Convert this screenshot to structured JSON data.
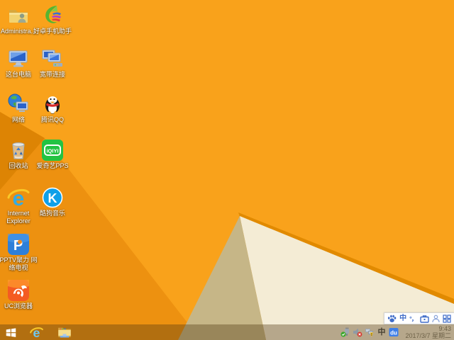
{
  "colors": {
    "base": "#F9A21B",
    "shade_mid": "#ED9110",
    "shade_dark": "#DD8404",
    "fold": "#E18A00",
    "cream": "#F4ECD5",
    "tan": "#C6B687",
    "accent_blue": "#3E6BC8",
    "iqiyi_green": "#23C343",
    "kugou_blue": "#0FA0E8"
  },
  "desktop": {
    "icons": [
      {
        "label": "Administra...",
        "kind": "user-folder"
      },
      {
        "label": "好卓手机助手",
        "kind": "phone-assistant"
      },
      {
        "label": "这台电脑",
        "kind": "this-pc"
      },
      {
        "label": "宽带连接",
        "kind": "broadband"
      },
      {
        "label": "网络",
        "kind": "network"
      },
      {
        "label": "腾讯QQ",
        "kind": "qq"
      },
      {
        "label": "回收站",
        "kind": "recycle-bin"
      },
      {
        "label": "爱奇艺PPS",
        "kind": "iqiyi",
        "badge": "iQIYI"
      },
      {
        "label": "Internet Explorer",
        "kind": "ie",
        "badge": "e"
      },
      {
        "label": "酷狗音乐",
        "kind": "kugou",
        "badge": "K"
      },
      {
        "label": "PPTV聚力 网络电视",
        "kind": "pptv",
        "badge": "P"
      },
      {
        "label": "UC浏览器",
        "kind": "uc-browser"
      }
    ]
  },
  "taskbar": {
    "ie_badge": "e"
  },
  "tray": {
    "ime_indicator": "中",
    "baidu_label": "du"
  },
  "clock": {
    "time": "9:43",
    "date": "2017/3/7 星期二"
  },
  "language_bar": {
    "mode": "中",
    "punctuation": "°，"
  }
}
